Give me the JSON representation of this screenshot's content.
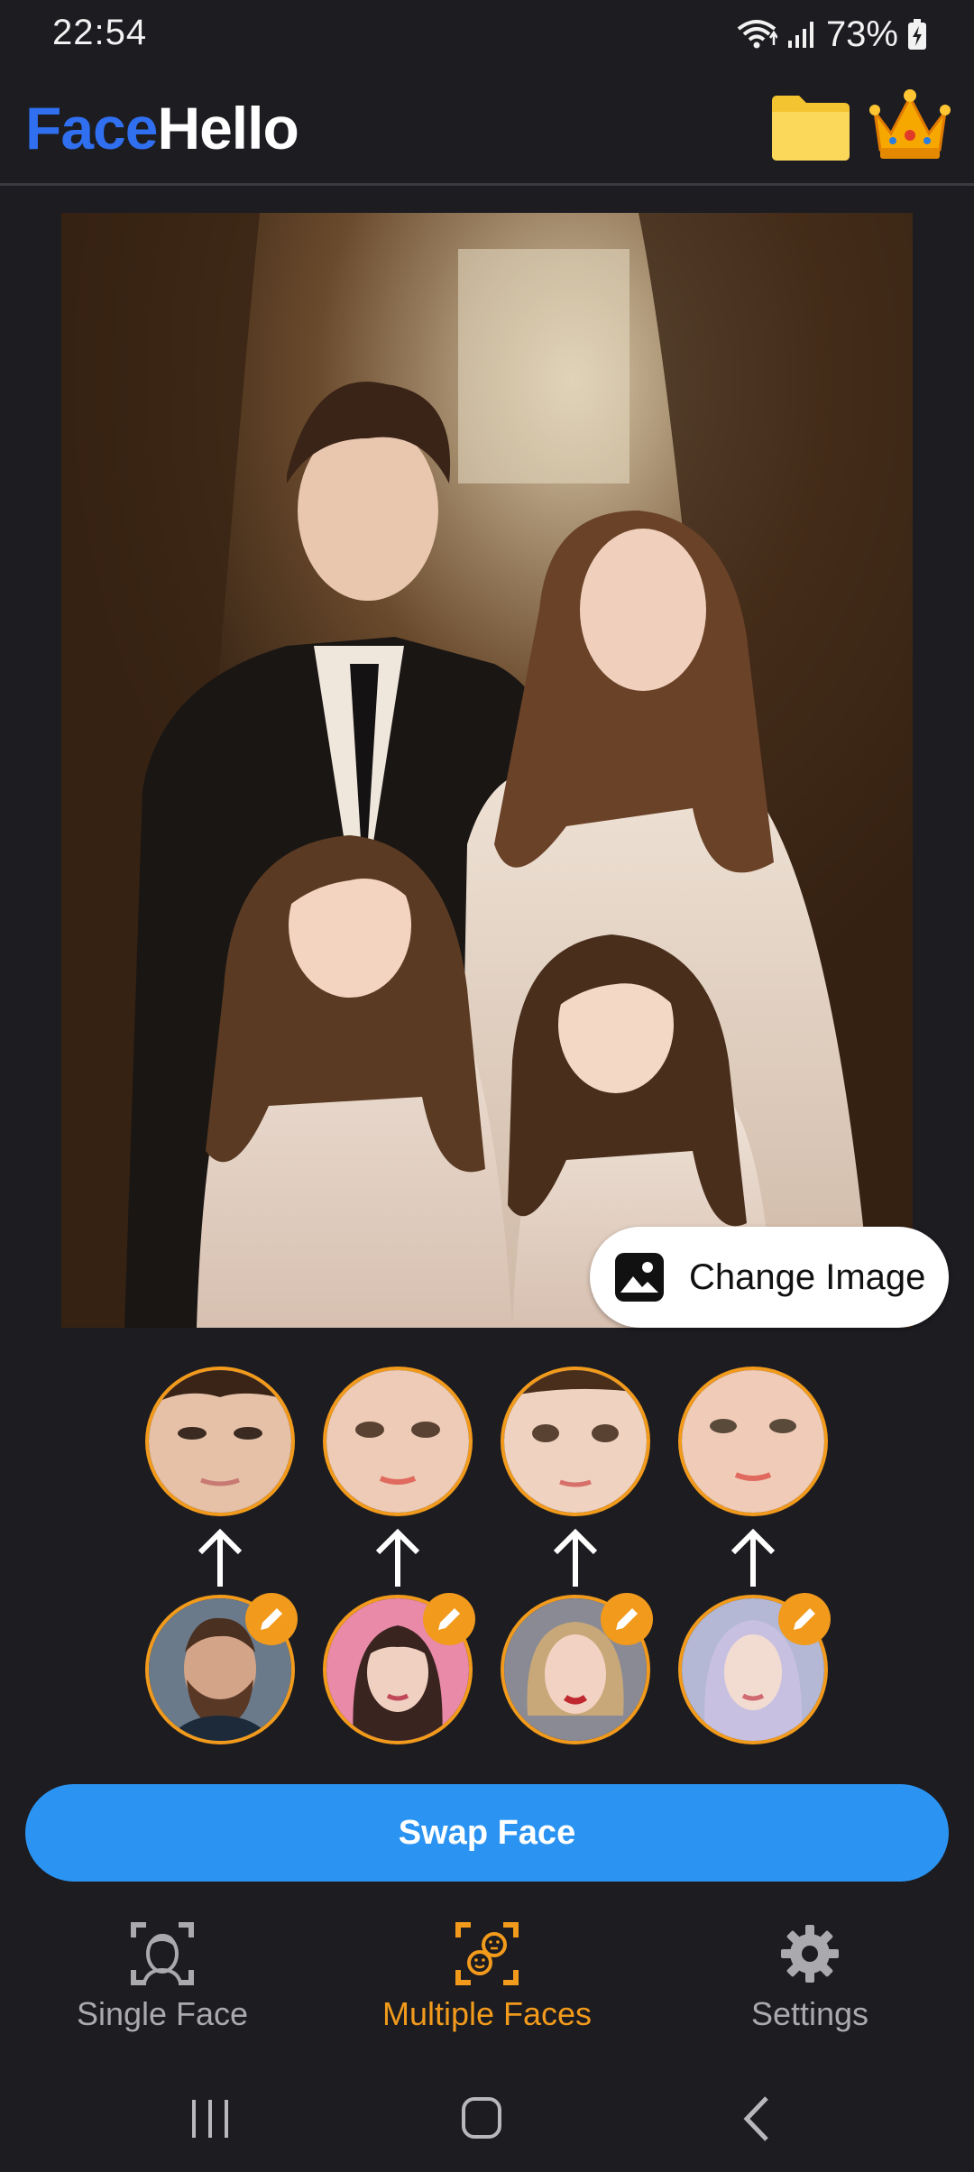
{
  "status_bar": {
    "time": "22:54",
    "battery_percent": "73%",
    "icons": [
      "wifi-icon",
      "signal-icon",
      "battery-charging-icon"
    ]
  },
  "header": {
    "title_part1": "Face",
    "title_part2": "Hello",
    "title_part1_color": "#2f6ff0",
    "title_part2_color": "#ffffff",
    "actions": [
      "folder-icon",
      "crown-icon"
    ]
  },
  "main": {
    "change_image_label": "Change Image",
    "change_image_icon": "image-icon"
  },
  "faces": {
    "detected": [
      "detected-face-1",
      "detected-face-2",
      "detected-face-3",
      "detected-face-4"
    ],
    "replacements": [
      "replacement-face-1",
      "replacement-face-2",
      "replacement-face-3",
      "replacement-face-4"
    ],
    "accent_color": "#f19a1c"
  },
  "swap_button": {
    "label": "Swap Face",
    "color": "#2b94f2"
  },
  "bottom_nav": {
    "items": [
      {
        "label": "Single Face",
        "icon": "single-face-scan-icon",
        "active": false
      },
      {
        "label": "Multiple Faces",
        "icon": "multiple-faces-scan-icon",
        "active": true
      },
      {
        "label": "Settings",
        "icon": "gear-icon",
        "active": false
      }
    ],
    "active_color": "#f19a1c",
    "inactive_color": "#a9a9ae"
  },
  "system_nav": [
    "recents-icon",
    "home-icon",
    "back-icon"
  ]
}
